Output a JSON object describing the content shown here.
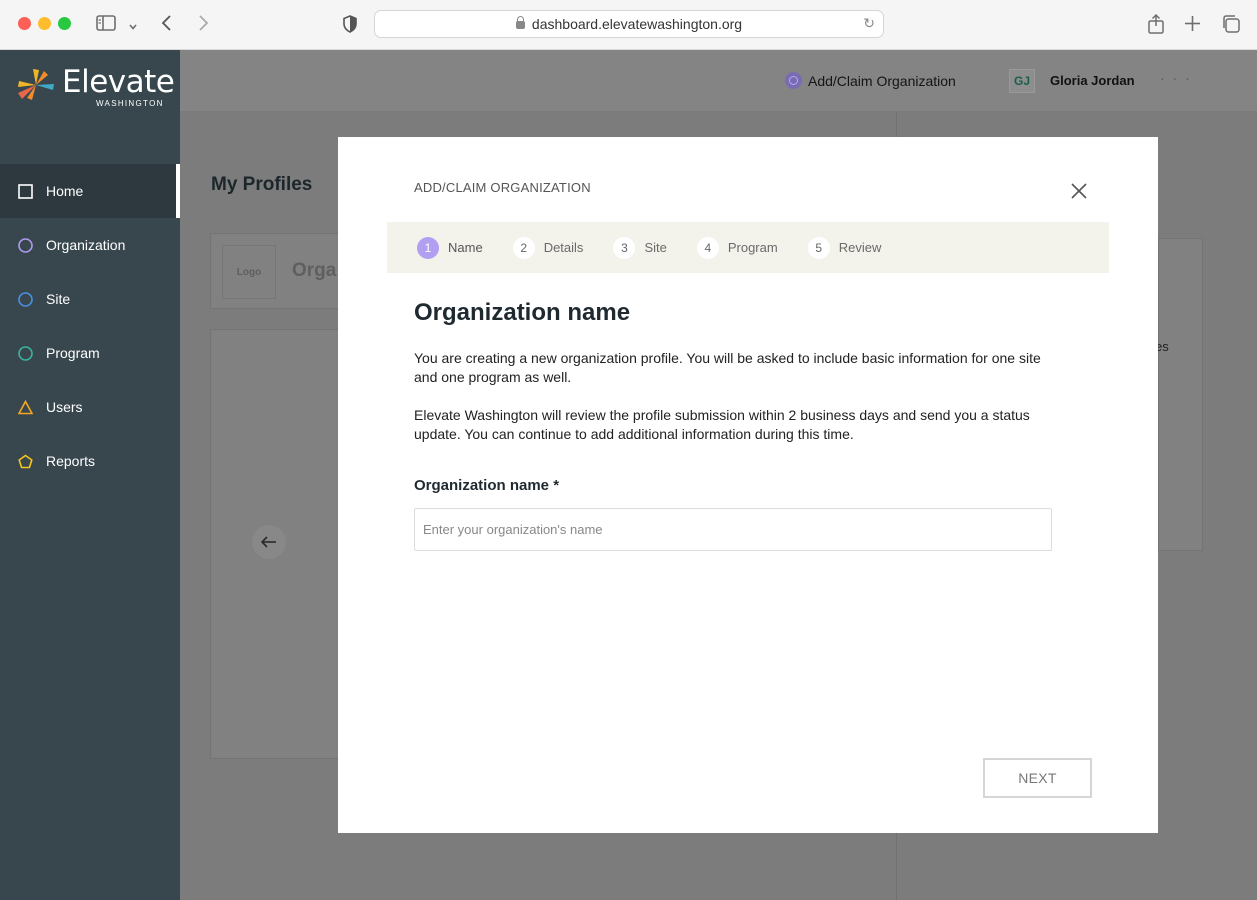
{
  "browser": {
    "url": "dashboard.elevatewashington.org",
    "icons": [
      "sidebar-toggle-icon",
      "chevron-down-icon",
      "back-icon",
      "forward-icon",
      "shield-icon",
      "lock-icon",
      "reload-icon",
      "share-icon",
      "plus-icon",
      "tabs-icon"
    ]
  },
  "brand": {
    "name": "Elevate",
    "sub": "WASHINGTON",
    "colors": [
      "#f0b429",
      "#e8664a",
      "#3fa9c6",
      "#f28c28"
    ]
  },
  "sidebar": {
    "items": [
      {
        "label": "Home",
        "icon": "square-icon",
        "color": "#ffffff",
        "active": true
      },
      {
        "label": "Organization",
        "icon": "circle-icon",
        "color": "#b09bf0"
      },
      {
        "label": "Site",
        "icon": "circle-icon",
        "color": "#4a90e2"
      },
      {
        "label": "Program",
        "icon": "circle-icon",
        "color": "#3bb3a0"
      },
      {
        "label": "Users",
        "icon": "triangle-icon",
        "color": "#f5a623"
      },
      {
        "label": "Reports",
        "icon": "pentagon-icon",
        "color": "#f5c518"
      }
    ]
  },
  "header": {
    "add_claim": "Add/Claim Organization",
    "avatar_initials": "GJ",
    "user_name": "Gloria Jordan",
    "more": "· · ·"
  },
  "background": {
    "title": "My Profiles",
    "logo_placeholder": "Logo",
    "org_partial": "Orga",
    "partial_text": "es"
  },
  "modal": {
    "label": "ADD/CLAIM ORGANIZATION",
    "steps": [
      {
        "num": "1",
        "label": "Name",
        "active": true
      },
      {
        "num": "2",
        "label": "Details"
      },
      {
        "num": "3",
        "label": "Site"
      },
      {
        "num": "4",
        "label": "Program"
      },
      {
        "num": "5",
        "label": "Review"
      }
    ],
    "heading": "Organization name",
    "paragraph1": "You are creating a new organization profile. You will be asked to include basic information for one site and one program as well.",
    "paragraph2": "Elevate Washington will review the profile submission within 2 business days and send you a status update. You can continue to add additional information during this time.",
    "field_label": "Organization name *",
    "field_placeholder": "Enter your organization's name",
    "field_value": "",
    "next_label": "NEXT"
  },
  "colors": {
    "sidebar_bg": "#38474e",
    "accent_purple": "#b39ff2",
    "stepper_bg": "#f3f3ec"
  }
}
